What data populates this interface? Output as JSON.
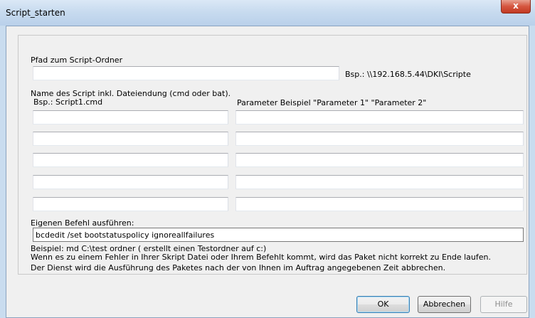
{
  "window": {
    "title": "Script_starten",
    "close_symbol": "x"
  },
  "folder": {
    "label": "Pfad zum Script-Ordner",
    "value": "",
    "example": "Bsp.: \\\\192.168.5.44\\DKI\\Scripte"
  },
  "scripts": {
    "name_label_line1": "Name des Script inkl. Dateiendung (cmd oder bat).",
    "name_label_line2": "Bsp.: Script1.cmd",
    "param_label": "Parameter Beispiel \"Parameter 1\" \"Parameter 2\"",
    "rows": [
      {
        "name": "",
        "params": ""
      },
      {
        "name": "",
        "params": ""
      },
      {
        "name": "",
        "params": ""
      },
      {
        "name": "",
        "params": ""
      },
      {
        "name": "",
        "params": ""
      }
    ]
  },
  "command": {
    "label": "Eigenen Befehl ausführen:",
    "value": "bcdedit /set bootstatuspolicy ignoreallfailures"
  },
  "notes": {
    "example": "Beispiel: md C:\\test  ordner ( erstellt einen Testordner auf c:)",
    "warning1": "Wenn es zu einem Fehler in Ihrer Skript Datei oder Ihrem Befehlt kommt, wird das Paket nicht korrekt zu Ende laufen.",
    "warning2": "Der Dienst wird die Ausführung des Paketes nach der von Ihnen im Auftrag angegebenen Zeit abbrechen."
  },
  "buttons": {
    "ok": "OK",
    "cancel": "Abbrechen",
    "help": "Hilfe"
  }
}
